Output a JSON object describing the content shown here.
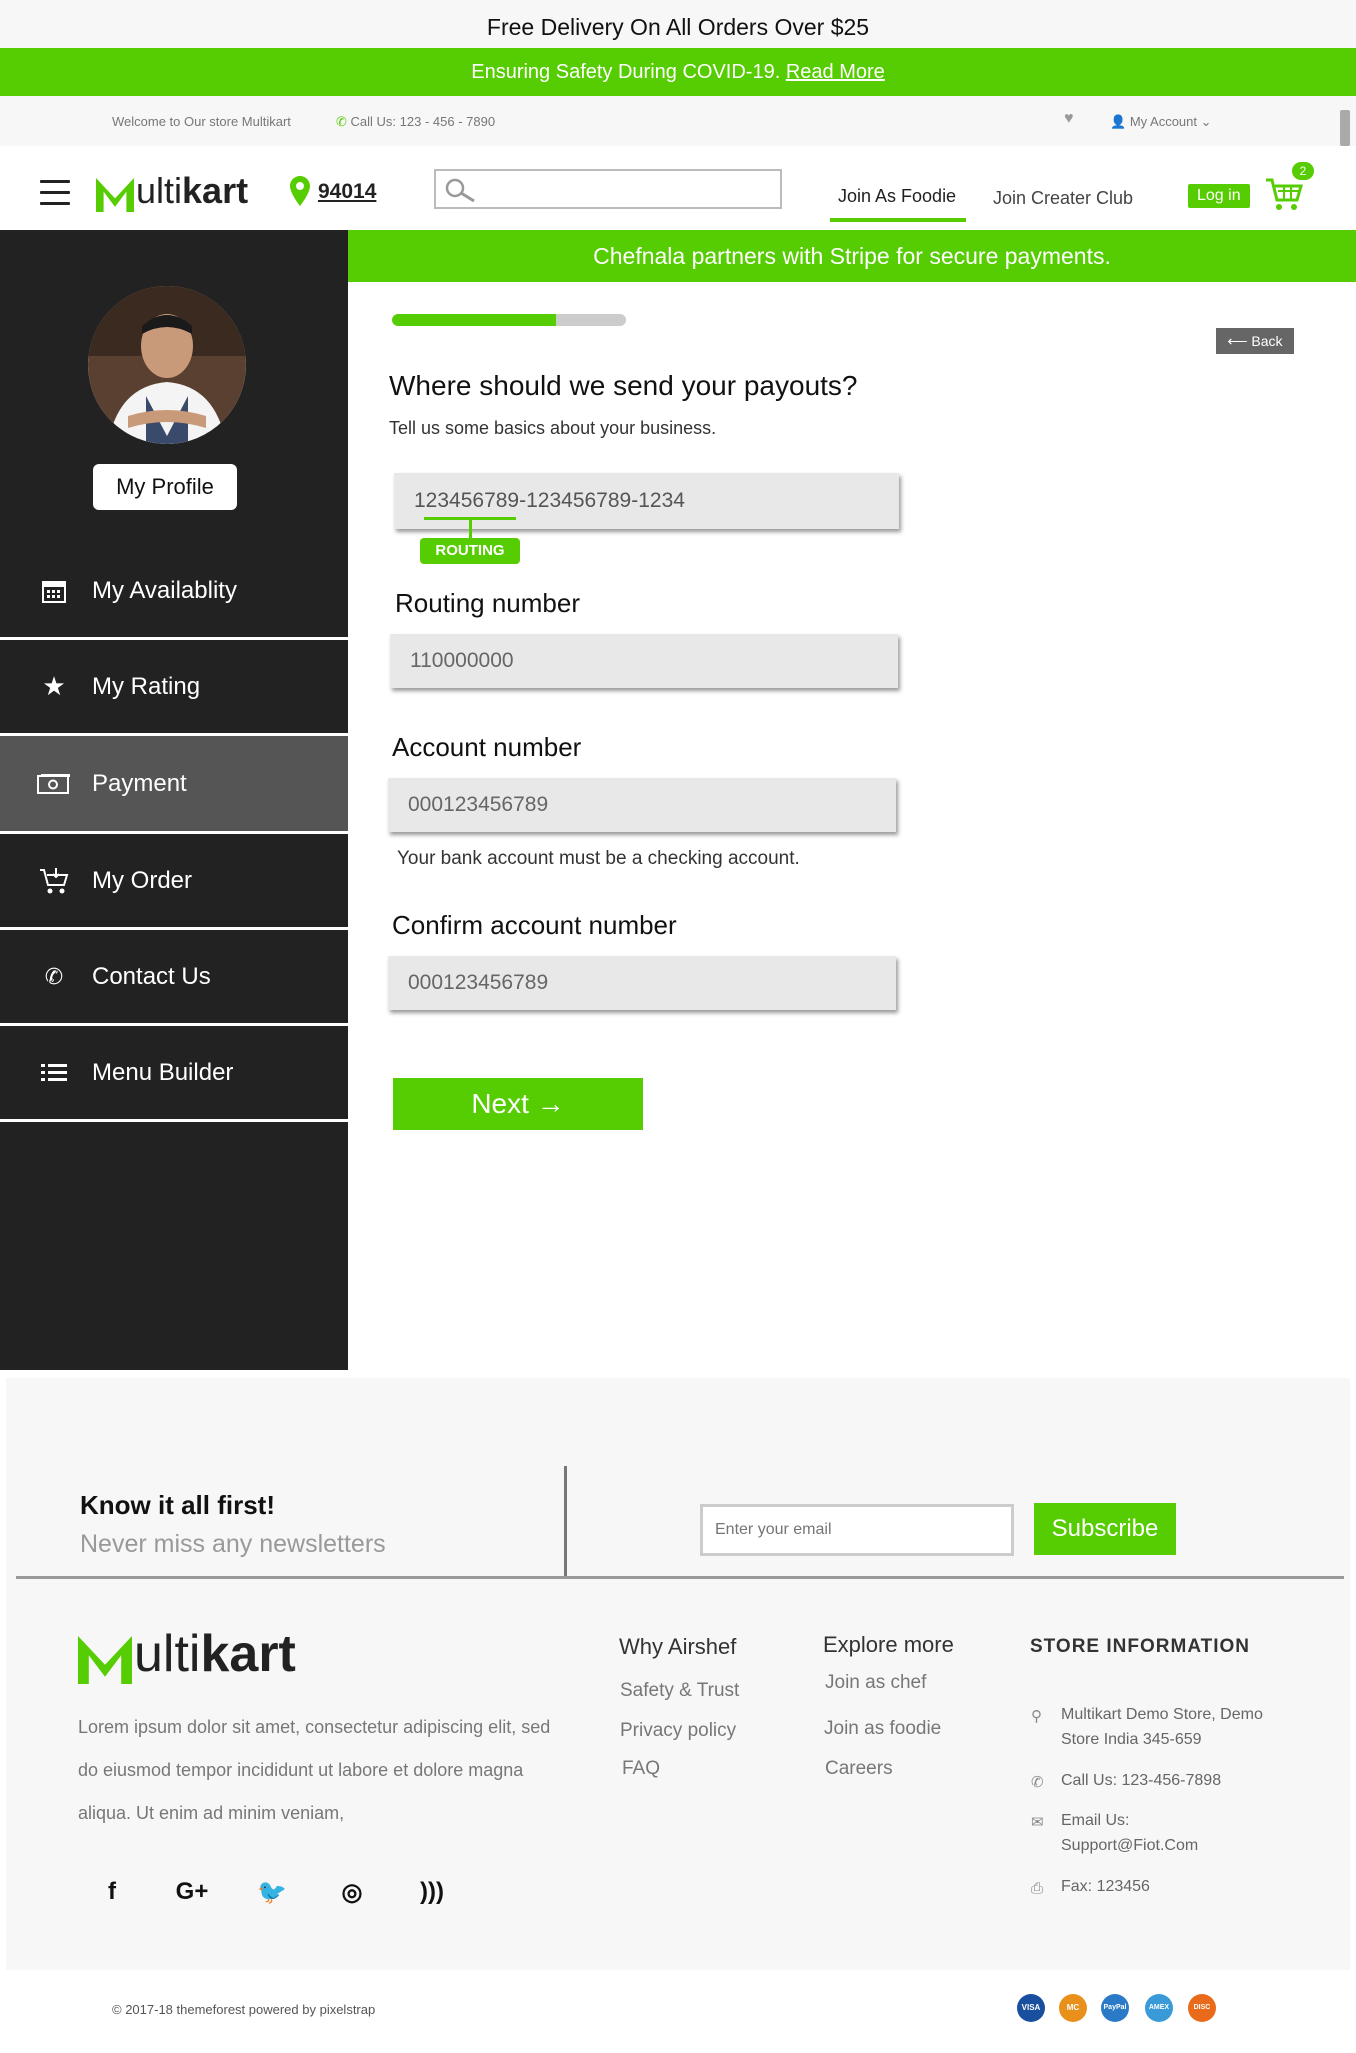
{
  "promo": {
    "text": "Free Delivery On All Orders Over $25"
  },
  "covid": {
    "text": "Ensuring Safety During COVID-19.",
    "link": "Read More"
  },
  "infobar": {
    "welcome": "Welcome to Our store Multikart",
    "call": "Call Us: 123 - 456 - 7890",
    "account": "My Account"
  },
  "header": {
    "logo_rest": "ulti",
    "logo_bold": "kart",
    "zip": "94014",
    "nav_foodie": "Join As Foodie",
    "nav_club": "Join Creater Club",
    "login": "Log in",
    "cart_count": "2"
  },
  "sidebar": {
    "profile_label": "My Profile",
    "items": [
      {
        "label": "My Availablity",
        "icon": "calendar-icon"
      },
      {
        "label": "My Rating",
        "icon": "star-icon"
      },
      {
        "label": "Payment",
        "icon": "money-icon"
      },
      {
        "label": "My Order",
        "icon": "cart-icon"
      },
      {
        "label": "Contact Us",
        "icon": "phone-icon"
      },
      {
        "label": "Menu Builder",
        "icon": "list-icon"
      }
    ]
  },
  "main": {
    "banner": "Chefnala partners with Stripe for secure payments.",
    "progress": 0.7,
    "back_label": "Back",
    "title": "Where should we send your payouts?",
    "subtitle": "Tell us some basics about your business.",
    "check_example": "123456789-123456789-1234",
    "routing_tag": "ROUTING",
    "routing_label": "Routing number",
    "routing_value": "110000000",
    "account_label": "Account number",
    "account_value": "000123456789",
    "account_help": "Your bank account must be a checking account.",
    "confirm_label": "Confirm account number",
    "confirm_value": "000123456789",
    "next_label": "Next →"
  },
  "footer": {
    "newsletter_title": "Know it all first!",
    "newsletter_sub": "Never miss any newsletters",
    "email_placeholder": "Enter your email",
    "subscribe_label": "Subscribe",
    "logo_rest": "ulti",
    "logo_bold": "kart",
    "lorem": "Lorem ipsum dolor sit amet, consectetur adipiscing elit, sed do eiusmod tempor incididunt ut labore et dolore magna aliqua. Ut enim ad minim veniam,",
    "col1": {
      "title": "Why Airshef",
      "links": [
        "Safety & Trust",
        "Privacy policy",
        "FAQ"
      ]
    },
    "col2": {
      "title": "Explore more",
      "links": [
        "Join as chef",
        "Join as foodie",
        "Careers"
      ]
    },
    "store": {
      "title": "STORE INFORMATION",
      "address": "Multikart Demo Store, Demo Store India 345-659",
      "call": "Call Us: 123-456-7898",
      "email": "Email Us: Support@Fiot.Com",
      "fax": "Fax: 123456"
    },
    "copyright": "© 2017-18 themeforest powered by pixelstrap",
    "payments": [
      "VISA",
      "MC",
      "PayPal",
      "AMEX",
      "DISC"
    ]
  },
  "colors": {
    "accent": "#56cc02",
    "sidebar": "#222222",
    "active": "#555555"
  }
}
